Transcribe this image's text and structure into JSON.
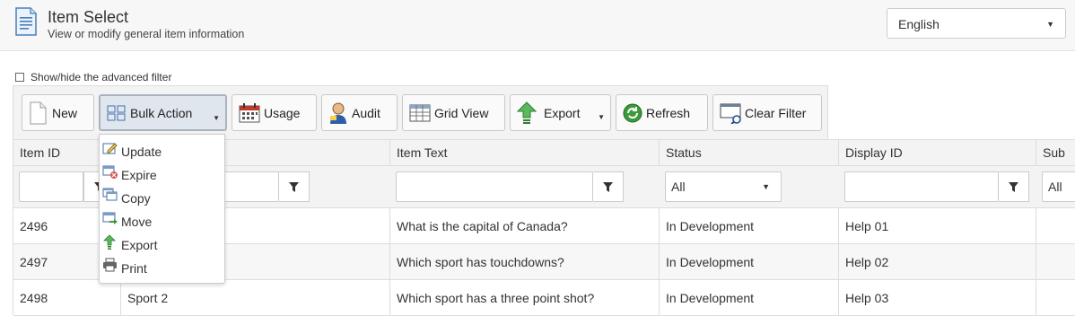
{
  "header": {
    "title": "Item Select",
    "subtitle": "View or modify general item information",
    "language": "English"
  },
  "advanced_filter_label": "Show/hide the advanced filter",
  "toolbar": {
    "new": "New",
    "bulk_action": "Bulk Action",
    "usage": "Usage",
    "audit": "Audit",
    "grid_view": "Grid View",
    "export": "Export",
    "refresh": "Refresh",
    "clear_filter": "Clear Filter"
  },
  "bulk_menu": [
    "Update",
    "Expire",
    "Copy",
    "Move",
    "Export",
    "Print"
  ],
  "grid": {
    "columns": [
      "Item ID",
      "",
      "Item Text",
      "Status",
      "Display ID",
      "Sub"
    ],
    "filters": {
      "status": "All",
      "sub": "All"
    },
    "rows": [
      [
        "2496",
        "",
        "What is the capital of Canada?",
        "In Development",
        "Help 01"
      ],
      [
        "2497",
        "",
        "Which sport has touchdowns?",
        "In Development",
        "Help 02"
      ],
      [
        "2498",
        "Sport 2",
        "Which sport has a three point shot?",
        "In Development",
        "Help 03"
      ]
    ]
  }
}
